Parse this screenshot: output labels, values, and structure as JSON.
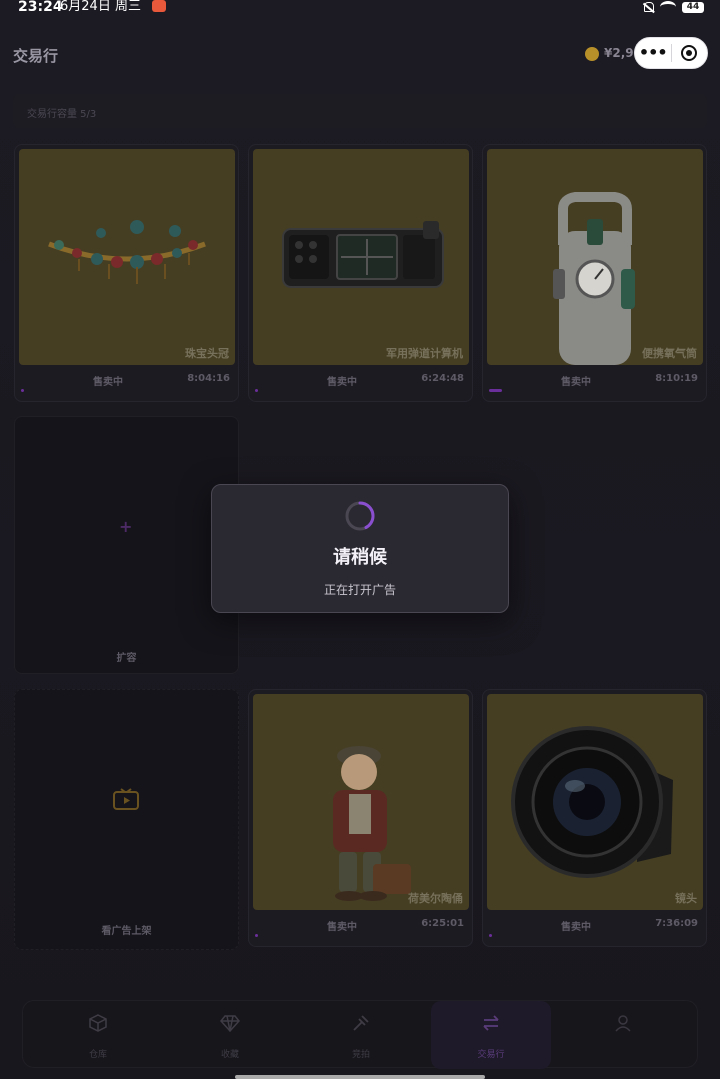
{
  "status_bar": {
    "time": "23:24",
    "date": "6月24日 周三",
    "battery": "44"
  },
  "header": {
    "title": "交易行",
    "balance": "¥2,907",
    "more_glyph": "•••"
  },
  "capacity": {
    "label": "交易行容量 5/3"
  },
  "listings": [
    {
      "name": "珠宝头冠",
      "status": "售卖中",
      "time": "8:04:16",
      "progress": 0.01
    },
    {
      "name": "军用弹道计算机",
      "status": "售卖中",
      "time": "6:24:48",
      "progress": 0.01
    },
    {
      "name": "便携氧气筒",
      "status": "售卖中",
      "time": "8:10:19",
      "progress": 0.06
    },
    {
      "name": "荷美尔陶俑",
      "status": "售卖中",
      "time": "6:25:01",
      "progress": 0.01
    },
    {
      "name": "镜头",
      "status": "售卖中",
      "time": "7:36:09",
      "progress": 0.01
    }
  ],
  "empty_slots": {
    "expand_label": "扩容",
    "plus_glyph": "+",
    "ad_label": "看广告上架"
  },
  "bottom_nav": {
    "items": [
      {
        "label": "仓库",
        "icon": "box-icon"
      },
      {
        "label": "收藏",
        "icon": "diamond-icon"
      },
      {
        "label": "竞拍",
        "icon": "hammer-icon"
      },
      {
        "label": "交易行",
        "icon": "swap-icon",
        "active": true
      },
      {
        "label": "",
        "icon": "person-icon"
      }
    ]
  },
  "dialog": {
    "title": "请稍候",
    "message": "正在打开广告"
  },
  "colors": {
    "accent": "#7b3fb8",
    "item_background": "#453e23",
    "dialog_background": "#2a2830"
  }
}
